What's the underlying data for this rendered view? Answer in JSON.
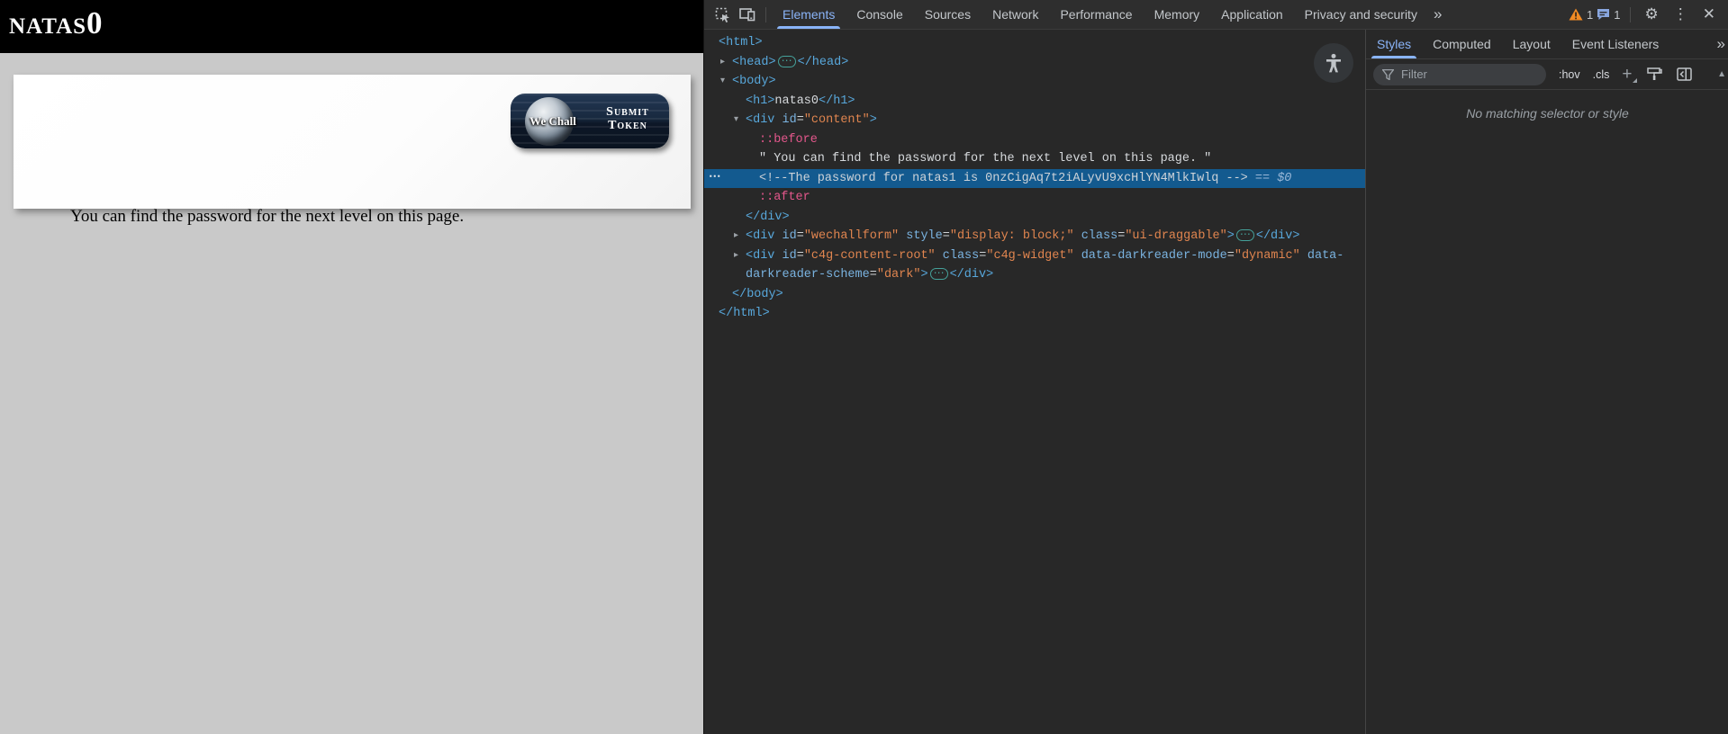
{
  "page": {
    "title": "natas0",
    "content_text": "You can find the password for the next level on this page.",
    "wechall_button": {
      "logo_text": "We Chall",
      "label_line1": "Submit",
      "label_line2": "Token"
    }
  },
  "devtools": {
    "toolbar": {
      "tabs": [
        "Elements",
        "Console",
        "Sources",
        "Network",
        "Performance",
        "Memory",
        "Application",
        "Privacy and security"
      ],
      "active_tab": "Elements",
      "warning_count": "1",
      "message_count": "1"
    },
    "icons": {
      "more_tabs": "»",
      "gear": "⚙",
      "kebab": "⋮",
      "close": "✕",
      "expand_inline": "⋯",
      "row_dots": "⋯",
      "arrow_open": "▾",
      "arrow_closed": "▸",
      "scroll_up": "▲",
      "plus": "+"
    },
    "colors": {
      "accent_blue": "#8ab4f8",
      "selection_blue": "#135a8f",
      "tag_blue": "#58a8dc",
      "attr_blue": "#7ab3e0",
      "value_orange": "#e0854f",
      "pseudo_pink": "#e4578c",
      "warning_orange": "#f28b24",
      "panel_bg": "#282828",
      "toolbar_bg": "#2e2e2e"
    },
    "elements_tree": {
      "lines": [
        {
          "name": "node-html-open",
          "indent": 0,
          "tokens": [
            [
              "tag",
              "<html>"
            ]
          ]
        },
        {
          "name": "node-head",
          "indent": 1,
          "arrow": "closed",
          "tokens": [
            [
              "tag",
              "<head>"
            ],
            [
              "expand",
              "⋯"
            ],
            [
              "tag",
              "</head>"
            ]
          ]
        },
        {
          "name": "node-body-open",
          "indent": 1,
          "arrow": "open",
          "tokens": [
            [
              "tag",
              "<body>"
            ]
          ]
        },
        {
          "name": "node-h1",
          "indent": 2,
          "tokens": [
            [
              "tag",
              "<h1>"
            ],
            [
              "text",
              "natas0"
            ],
            [
              "tag",
              "</h1>"
            ]
          ]
        },
        {
          "name": "node-div-content-open",
          "indent": 2,
          "arrow": "open",
          "tokens": [
            [
              "tag",
              "<div"
            ],
            [
              "attr",
              " id"
            ],
            [
              "punct",
              "="
            ],
            [
              "value",
              "\"content\""
            ],
            [
              "tag",
              ">"
            ]
          ]
        },
        {
          "name": "node-pseudo-before",
          "indent": 3,
          "tokens": [
            [
              "pseudo",
              "::before"
            ]
          ]
        },
        {
          "name": "node-text",
          "indent": 3,
          "tokens": [
            [
              "text",
              "\" You can find the password for the next level on this page. \""
            ]
          ]
        },
        {
          "name": "node-password-comment",
          "indent": 3,
          "selected": true,
          "dots": true,
          "tokens": [
            [
              "comment",
              "<!--The password for natas1 is 0nzCigAq7t2iALyvU9xcHlYN4MlkIwlq -->"
            ],
            [
              "eq",
              " == $0"
            ]
          ]
        },
        {
          "name": "node-pseudo-after",
          "indent": 3,
          "tokens": [
            [
              "pseudo",
              "::after"
            ]
          ]
        },
        {
          "name": "node-div-content-close",
          "indent": 2,
          "tokens": [
            [
              "tag",
              "</div>"
            ]
          ]
        },
        {
          "name": "node-div-wechallform",
          "indent": 2,
          "arrow": "closed",
          "tokens": [
            [
              "tag",
              "<div"
            ],
            [
              "attr",
              " id"
            ],
            [
              "punct",
              "="
            ],
            [
              "value",
              "\"wechallform\""
            ],
            [
              "attr",
              " style"
            ],
            [
              "punct",
              "="
            ],
            [
              "value",
              "\"display: block;\""
            ],
            [
              "attr",
              " class"
            ],
            [
              "punct",
              "="
            ],
            [
              "value",
              "\"ui-draggable\""
            ],
            [
              "tag",
              ">"
            ],
            [
              "expand",
              "⋯"
            ],
            [
              "tag",
              "</div>"
            ]
          ]
        },
        {
          "name": "node-div-c4g",
          "indent": 2,
          "arrow": "closed",
          "tokens": [
            [
              "tag",
              "<div"
            ],
            [
              "attr",
              " id"
            ],
            [
              "punct",
              "="
            ],
            [
              "value",
              "\"c4g-content-root\""
            ],
            [
              "attr",
              " class"
            ],
            [
              "punct",
              "="
            ],
            [
              "value",
              "\"c4g-widget\""
            ],
            [
              "attr",
              " data-darkreader-mode"
            ],
            [
              "punct",
              "="
            ],
            [
              "value",
              "\"dynamic\""
            ],
            [
              "attr",
              " data-"
            ]
          ]
        },
        {
          "name": "node-div-c4g-wrap",
          "indent": 2,
          "tokens": [
            [
              "attr",
              "darkreader-scheme"
            ],
            [
              "punct",
              "="
            ],
            [
              "value",
              "\"dark\""
            ],
            [
              "tag",
              ">"
            ],
            [
              "expand",
              "⋯"
            ],
            [
              "tag",
              "</div>"
            ]
          ]
        },
        {
          "name": "node-body-close",
          "indent": 1,
          "tokens": [
            [
              "tag",
              "</body>"
            ]
          ]
        },
        {
          "name": "node-html-close",
          "indent": 0,
          "tokens": [
            [
              "tag",
              "</html>"
            ]
          ]
        }
      ]
    },
    "styles_panel": {
      "tabs": [
        "Styles",
        "Computed",
        "Layout",
        "Event Listeners"
      ],
      "active_tab": "Styles",
      "filter_placeholder": "Filter",
      "pseudo_toggle": ":hov",
      "class_toggle": ".cls",
      "empty_message": "No matching selector or style"
    }
  }
}
